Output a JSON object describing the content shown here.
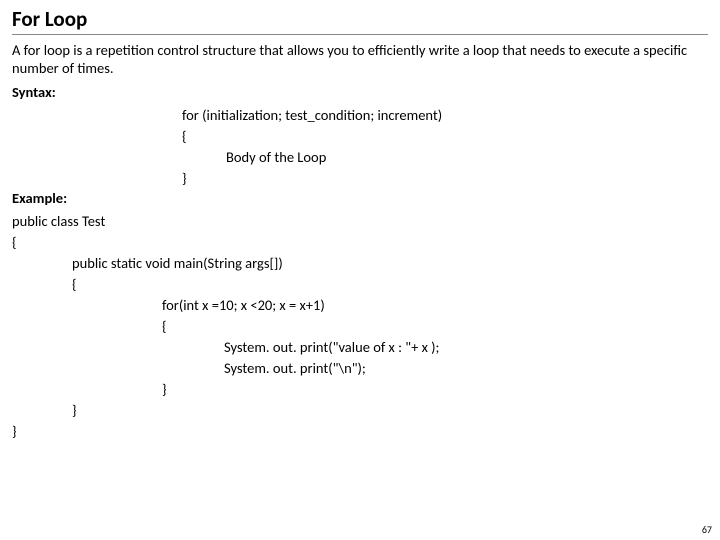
{
  "title": "For Loop",
  "description": "A for loop is a repetition control structure that allows you to efficiently write a loop that needs to execute a specific number of times.",
  "syntax": {
    "label": "Syntax:",
    "line1": "for (initialization; test_condition; increment)",
    "open": "{",
    "body": "Body of the Loop",
    "close": "}"
  },
  "example": {
    "label": "Example:",
    "lines": {
      "l0": "public class Test",
      "l1": "{",
      "l2": "public static void main(String args[])",
      "l3": "{",
      "l4": "for(int x =10; x <20; x = x+1)",
      "l5": "{",
      "l6": "System. out. print(\"value of x : \"+ x );",
      "l7": "System. out. print(\"\\n\");",
      "l8": "}",
      "l9": "}",
      "l10": "}"
    }
  },
  "page_number": "67"
}
